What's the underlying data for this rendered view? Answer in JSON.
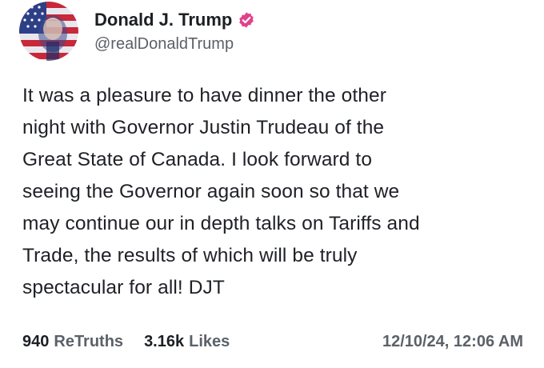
{
  "author": {
    "display_name": "Donald J. Trump",
    "handle": "@realDonaldTrump",
    "verified": true,
    "avatar_icon": "flag-portrait-avatar",
    "verified_color": "#e0428c"
  },
  "post": {
    "text": "It was a pleasure to have dinner the other\nnight with Governor Justin Trudeau of the\nGreat State of Canada. I look forward to\nseeing the Governor again soon so that we\nmay continue our in depth talks on Tariffs and\nTrade, the results of which will be truly\nspectacular for all! DJT"
  },
  "stats": {
    "retruths_count": "940",
    "retruths_label": "ReTruths",
    "likes_count": "3.16k",
    "likes_label": "Likes"
  },
  "timestamp": "12/10/24, 12:06 AM"
}
